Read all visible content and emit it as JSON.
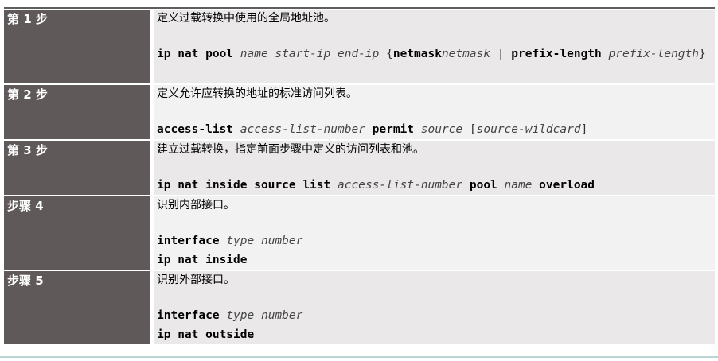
{
  "steps": [
    {
      "label": "第 1 步",
      "description": "定义过载转换中使用的全局地址池。",
      "cmd": [
        {
          "b": "ip nat pool"
        },
        {
          "t": " "
        },
        {
          "i": "name start-ip end-ip"
        },
        {
          "t": " {"
        },
        {
          "b": "netmask"
        },
        {
          "i": "netmask"
        },
        {
          "t": " | "
        },
        {
          "b": "prefix-length"
        },
        {
          "t": " "
        },
        {
          "i": "prefix-length"
        },
        {
          "t": "}"
        }
      ]
    },
    {
      "label": "第 2 步",
      "description": "定义允许应转换的地址的标准访问列表。",
      "cmd": [
        {
          "b": "access-list"
        },
        {
          "t": " "
        },
        {
          "i": "access-list-number"
        },
        {
          "t": " "
        },
        {
          "b": "permit"
        },
        {
          "t": " "
        },
        {
          "i": "source"
        },
        {
          "t": " ["
        },
        {
          "i": "source-wildcard"
        },
        {
          "t": "]"
        }
      ]
    },
    {
      "label": "第 3 步",
      "description": "建立过载转换，指定前面步骤中定义的访问列表和池。",
      "cmd": [
        {
          "b": "ip nat inside source list"
        },
        {
          "t": " "
        },
        {
          "i": "access-list-number"
        },
        {
          "t": " "
        },
        {
          "b": "pool"
        },
        {
          "t": " "
        },
        {
          "i": "name"
        },
        {
          "t": " "
        },
        {
          "b": "overload"
        }
      ]
    },
    {
      "label": "步骤 4",
      "description": "识别内部接口。",
      "lines": [
        [
          {
            "b": "interface"
          },
          {
            "t": " "
          },
          {
            "i": "type number"
          }
        ],
        [
          {
            "b": "ip nat inside"
          }
        ]
      ]
    },
    {
      "label": "步骤 5",
      "description": "识别外部接口。",
      "lines": [
        [
          {
            "b": "interface"
          },
          {
            "t": " "
          },
          {
            "i": "type number"
          }
        ],
        [
          {
            "b": "ip nat outside"
          }
        ]
      ]
    }
  ]
}
